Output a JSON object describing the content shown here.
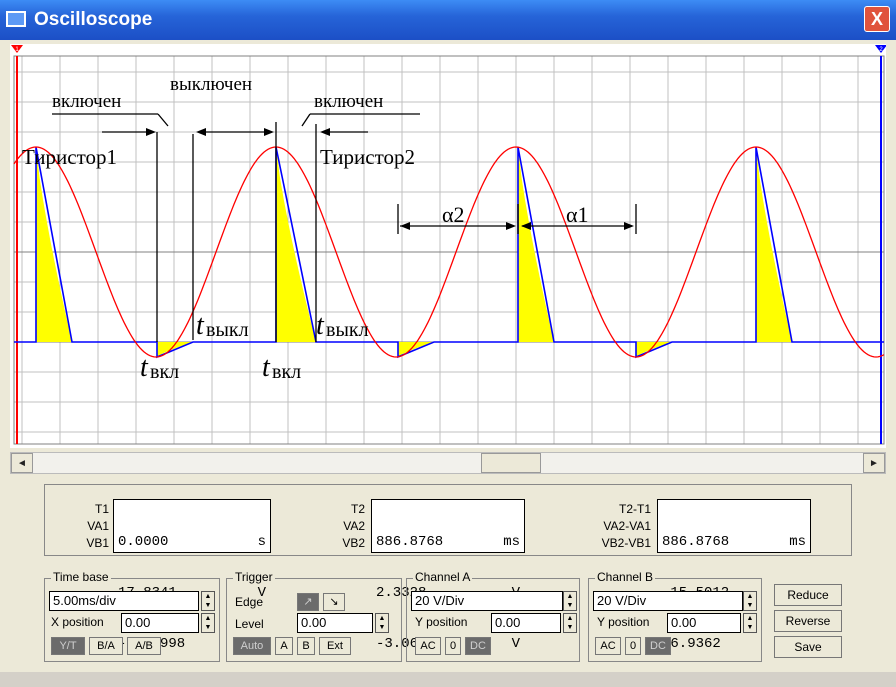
{
  "window": {
    "title": "Oscilloscope",
    "close": "X"
  },
  "annotations": {
    "on1": "включен",
    "off": "выключен",
    "on2": "включен",
    "thy1": "Тиристор1",
    "thy2": "Тиристор2",
    "alpha2": "α2",
    "alpha1": "α1",
    "t_off1_t": "t",
    "t_off1_s": "выкл",
    "t_off2_t": "t",
    "t_off2_s": "выкл",
    "t_on1_t": "t",
    "t_on1_s": "вкл",
    "t_on2_t": "t",
    "t_on2_s": "вкл"
  },
  "markers": {
    "m1": "1",
    "m2": "2"
  },
  "scrollbar": {
    "left": "◄",
    "right": "►"
  },
  "measurements": {
    "col1": {
      "labels": [
        "T1",
        "VA1",
        "VB1"
      ],
      "values": [
        [
          "0.0000",
          "s"
        ],
        [
          "17.8341",
          "V"
        ],
        [
          "-29.9998",
          "V"
        ]
      ]
    },
    "col2": {
      "labels": [
        "T2",
        "VA2",
        "VB2"
      ],
      "values": [
        [
          "886.8768",
          "ms"
        ],
        [
          "2.3328",
          "V"
        ],
        [
          "-3.0637",
          "V"
        ]
      ]
    },
    "col3": {
      "labels": [
        "T2-T1",
        "VA2-VA1",
        "VB2-VB1"
      ],
      "values": [
        [
          "886.8768",
          "ms"
        ],
        [
          "-15.5012",
          "V"
        ],
        [
          "26.9362",
          "V"
        ]
      ]
    }
  },
  "timebase": {
    "title": "Time base",
    "value": "5.00ms/div",
    "xpos_label": "X position",
    "xpos_value": "0.00",
    "modes": [
      "Y/T",
      "B/A",
      "A/B"
    ]
  },
  "trigger": {
    "title": "Trigger",
    "edge_label": "Edge",
    "edge_icons": [
      "↗",
      "↘"
    ],
    "level_label": "Level",
    "level_value": "0.00",
    "buttons": [
      "Auto",
      "A",
      "B",
      "Ext"
    ]
  },
  "channel_a": {
    "title": "Channel A",
    "value": "20 V/Div",
    "ypos_label": "Y position",
    "ypos_value": "0.00",
    "coupling": [
      "AC",
      "0",
      "DC"
    ]
  },
  "channel_b": {
    "title": "Channel B",
    "value": "20 V/Div",
    "ypos_label": "Y position",
    "ypos_value": "0.00",
    "coupling": [
      "AC",
      "0",
      "DC"
    ]
  },
  "actions": {
    "reduce": "Reduce",
    "reverse": "Reverse",
    "save": "Save"
  },
  "colors": {
    "sine": "#ff0000",
    "trace": "#0000ff",
    "fill": "#ffff00",
    "grid": "#c0c0c0",
    "titlebar": "#2664d8"
  }
}
